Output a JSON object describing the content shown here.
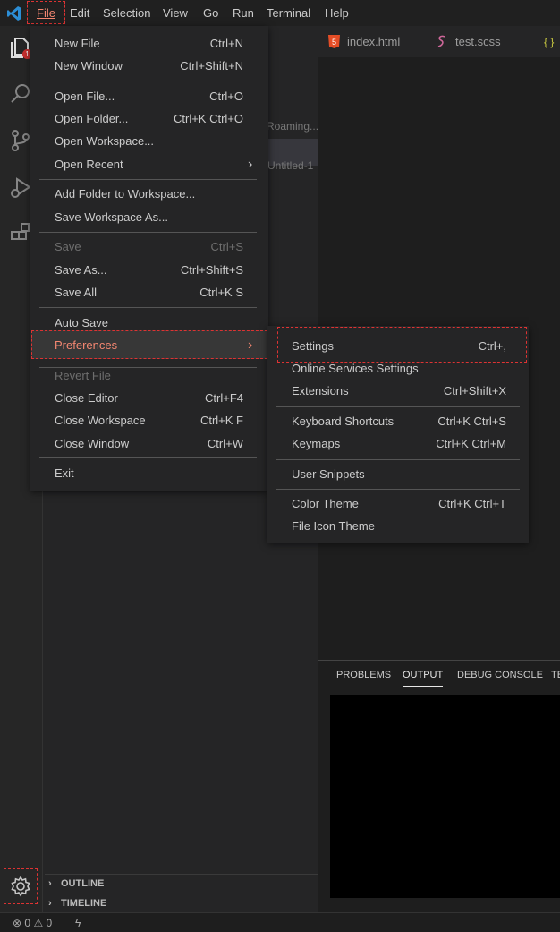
{
  "menubar": {
    "items": [
      "File",
      "Edit",
      "Selection",
      "View",
      "Go",
      "Run",
      "Terminal",
      "Help"
    ]
  },
  "activity": {
    "badge": "1"
  },
  "sidebar": {
    "faint_1": "Roaming...",
    "faint_2": "Untitled-1",
    "outline": "OUTLINE",
    "timeline": "TIMELINE"
  },
  "editor": {
    "tabs": [
      "index.html",
      "test.scss"
    ],
    "tab3_icon": "{ }"
  },
  "panel": {
    "tabs": [
      "PROBLEMS",
      "OUTPUT",
      "DEBUG CONSOLE",
      "TE"
    ]
  },
  "status": {
    "errors": "0",
    "warnings": "0"
  },
  "file_menu": {
    "items": [
      {
        "label": "New File",
        "shortcut": "Ctrl+N"
      },
      {
        "label": "New Window",
        "shortcut": "Ctrl+Shift+N"
      },
      {
        "label": "Open File...",
        "shortcut": "Ctrl+O"
      },
      {
        "label": "Open Folder...",
        "shortcut": "Ctrl+K Ctrl+O"
      },
      {
        "label": "Open Workspace...",
        "shortcut": ""
      },
      {
        "label": "Open Recent",
        "shortcut": ""
      },
      {
        "label": "Add Folder to Workspace...",
        "shortcut": ""
      },
      {
        "label": "Save Workspace As...",
        "shortcut": ""
      },
      {
        "label": "Save",
        "shortcut": "Ctrl+S"
      },
      {
        "label": "Save As...",
        "shortcut": "Ctrl+Shift+S"
      },
      {
        "label": "Save All",
        "shortcut": "Ctrl+K S"
      },
      {
        "label": "Auto Save",
        "shortcut": ""
      },
      {
        "label": "Preferences",
        "shortcut": ""
      },
      {
        "label": "Revert File",
        "shortcut": ""
      },
      {
        "label": "Close Editor",
        "shortcut": "Ctrl+F4"
      },
      {
        "label": "Close Workspace",
        "shortcut": "Ctrl+K F"
      },
      {
        "label": "Close Window",
        "shortcut": "Ctrl+W"
      },
      {
        "label": "Exit",
        "shortcut": ""
      }
    ]
  },
  "pref_menu": {
    "items": [
      {
        "label": "Settings",
        "shortcut": "Ctrl+,"
      },
      {
        "label": "Online Services Settings",
        "shortcut": ""
      },
      {
        "label": "Extensions",
        "shortcut": "Ctrl+Shift+X"
      },
      {
        "label": "Keyboard Shortcuts",
        "shortcut": "Ctrl+K Ctrl+S"
      },
      {
        "label": "Keymaps",
        "shortcut": "Ctrl+K Ctrl+M"
      },
      {
        "label": "User Snippets",
        "shortcut": ""
      },
      {
        "label": "Color Theme",
        "shortcut": "Ctrl+K Ctrl+T"
      },
      {
        "label": "File Icon Theme",
        "shortcut": ""
      }
    ]
  },
  "colors": {
    "accent_red": "#f48771",
    "highlight_border": "#dd3333"
  }
}
